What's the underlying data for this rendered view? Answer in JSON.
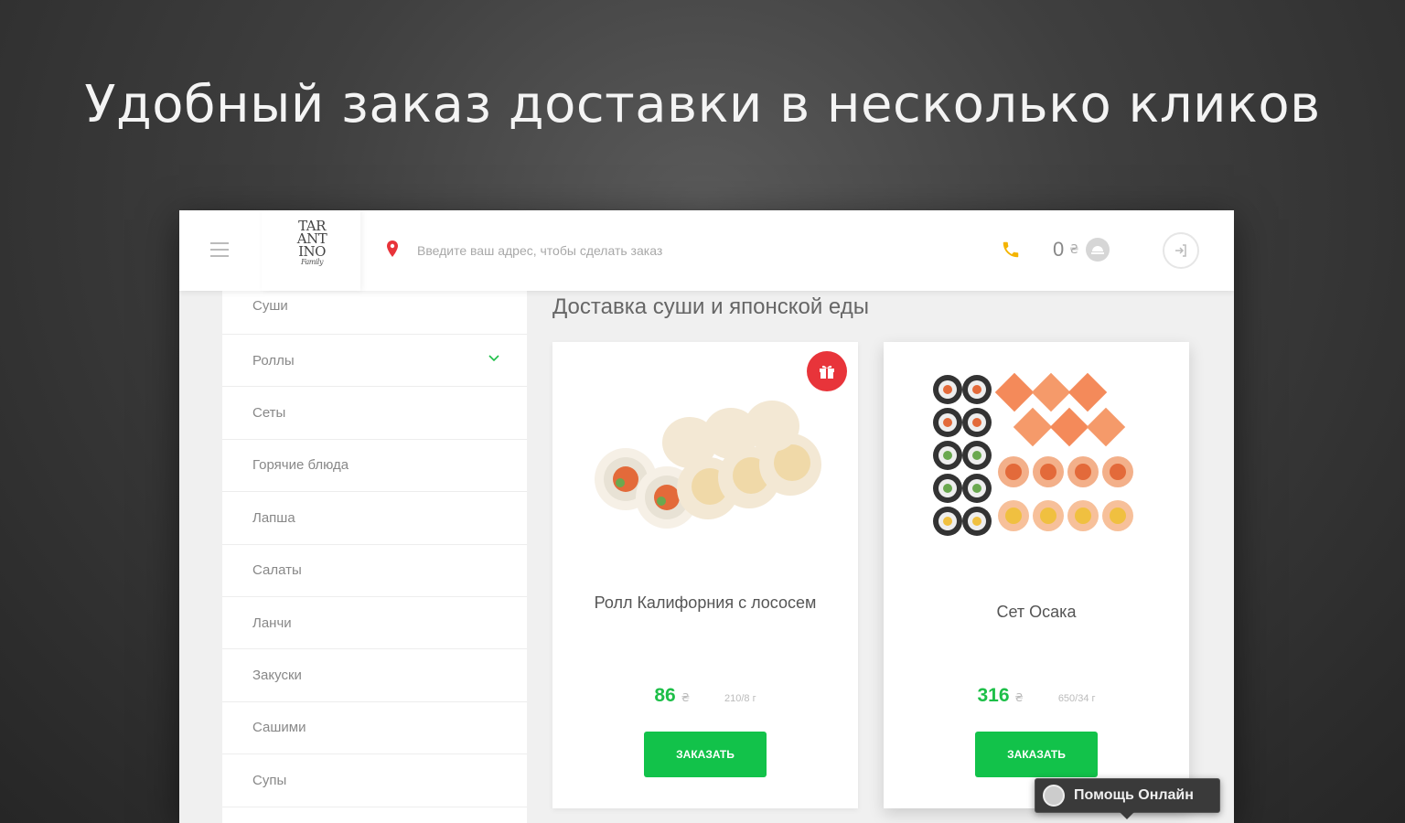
{
  "headline": "Удобный заказ доставки в несколько кликов",
  "header": {
    "logo_lines": [
      "TAR",
      "ANT",
      "INO"
    ],
    "logo_sub": "Family",
    "address_placeholder": "Введите ваш адрес, чтобы сделать заказ",
    "cart_count": "0",
    "cart_currency": "₴"
  },
  "sidebar": {
    "categories": [
      {
        "label": "Суши"
      },
      {
        "label": "Роллы",
        "expandable": true
      },
      {
        "label": "Сеты"
      },
      {
        "label": "Горячие блюда"
      },
      {
        "label": "Лапша"
      },
      {
        "label": "Салаты"
      },
      {
        "label": "Ланчи"
      },
      {
        "label": "Закуски"
      },
      {
        "label": "Сашими"
      },
      {
        "label": "Супы"
      }
    ]
  },
  "main": {
    "title": "Доставка суши и японской еды",
    "products": [
      {
        "name": "Ролл Калифорния с лососем",
        "price": "86",
        "currency": "₴",
        "weight": "210/8 г",
        "button": "Заказать",
        "badge": "gift-icon"
      },
      {
        "name": "Сет Осака",
        "price": "316",
        "currency": "₴",
        "weight": "650/34 г",
        "button": "Заказать"
      }
    ]
  },
  "help_widget": {
    "label": "Помощь Онлайн"
  },
  "colors": {
    "accent": "#12c24a",
    "price": "#1dbf48",
    "badge": "#e8343a",
    "phone": "#f4b400"
  }
}
